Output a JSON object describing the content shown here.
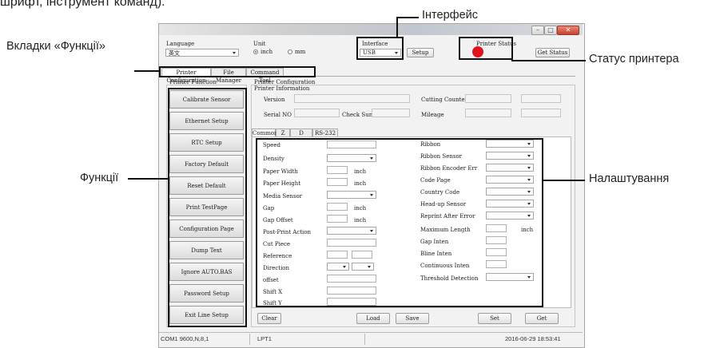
{
  "caption_fragment": "шрифт, інструмент команд).",
  "annotations": {
    "interface": "Інтерфейс",
    "tabs": "Вкладки «Функції»",
    "status": "Статус принтера",
    "functions": "Функції",
    "settings": "Налаштування"
  },
  "window": {
    "language_label": "Language",
    "language_value": "英文",
    "unit_label": "Unit",
    "unit_inch": "inch",
    "unit_mm": "mm",
    "interface_label": "Interface",
    "interface_value": "USB",
    "setup_button": "Setup",
    "printer_status_label": "Printer  Status",
    "get_status_button": "Get Status",
    "status_color": "#e0141e",
    "main_tabs": [
      "Printer Configuration",
      "File Manager",
      "Command Tool"
    ],
    "function_group": "Printer  Function",
    "function_buttons": [
      "Calibrate Sensor",
      "Ethernet Setup",
      "RTC Setup",
      "Factory Default",
      "Reset Default",
      "Print TestPage",
      "Configuration Page",
      "Dump Text",
      "Ignore AUTO.BAS",
      "Password Setup",
      "Exit Line Setup"
    ],
    "config_title": "Printer Configuration",
    "info_title": "Printer Information",
    "info": {
      "version": "Version",
      "serial": "Serial NO",
      "checksum": "Check Sum",
      "cutting": "Cutting Counter",
      "mileage": "Mileage"
    },
    "sub_tabs": [
      "Common",
      "Z",
      "D",
      "RS-232"
    ],
    "left_settings": {
      "speed": "Speed",
      "density": "Density",
      "paper_width": "Paper Width",
      "paper_height": "Paper Height",
      "media_sensor": "Media Sensor",
      "gap": "Gap",
      "gap_offset": "Gap Offset",
      "post_print": "Post-Print  Action",
      "cut_piece": "Cut  Piece",
      "reference": "Reference",
      "direction": "Direction",
      "offset": "offset",
      "shift_x": "Shift X",
      "shift_y": "Shift Y",
      "inch": "inch"
    },
    "right_settings": {
      "ribbon": "Ribbon",
      "ribbon_sensor": "Ribbon  Sensor",
      "ribbon_encoder": "Ribbon Encoder Err",
      "code_page": "Code Page",
      "country_code": "Country Code",
      "headup_sensor": "Head-up  Sensor",
      "reprint": "Reprint After  Error",
      "max_length": "Maximum Length",
      "gap_inten": "Gap Inten",
      "bline_inten": "Bline  Inten",
      "continuous_inten": "Continuous  Inten",
      "threshold": "Threshold  Detection",
      "inch": "inch"
    },
    "bottom_buttons": {
      "clear": "Clear",
      "load": "Load",
      "save": "Save",
      "set": "Set",
      "get": "Get"
    },
    "statusbar": {
      "com": "COM1 9600,N,8,1",
      "lpt": "LPT1",
      "datetime": "2016-06-29  18:53:41"
    }
  }
}
